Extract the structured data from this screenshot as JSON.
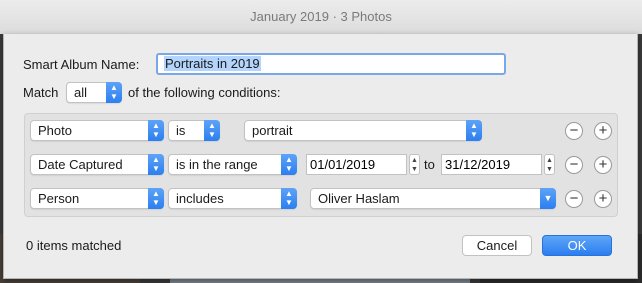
{
  "window": {
    "title": "January 2019 · 3 Photos"
  },
  "form": {
    "name_label": "Smart Album Name:",
    "name_value": "Portraits in 2019",
    "match_label": "Match",
    "match_value": "all",
    "match_suffix": "of the following conditions:"
  },
  "conditions": [
    {
      "field": "Photo",
      "operator": "is",
      "value": "portrait"
    },
    {
      "field": "Date Captured",
      "operator": "is in the range",
      "from": "01/01/2019",
      "to_label": "to",
      "to": "31/12/2019"
    },
    {
      "field": "Person",
      "operator": "includes",
      "value": "Oliver Haslam"
    }
  ],
  "footer": {
    "status": "0 items matched",
    "cancel_label": "Cancel",
    "ok_label": "OK"
  },
  "icons": {
    "remove": "−",
    "add": "+"
  },
  "colors": {
    "accent": "#2c7ff0"
  }
}
